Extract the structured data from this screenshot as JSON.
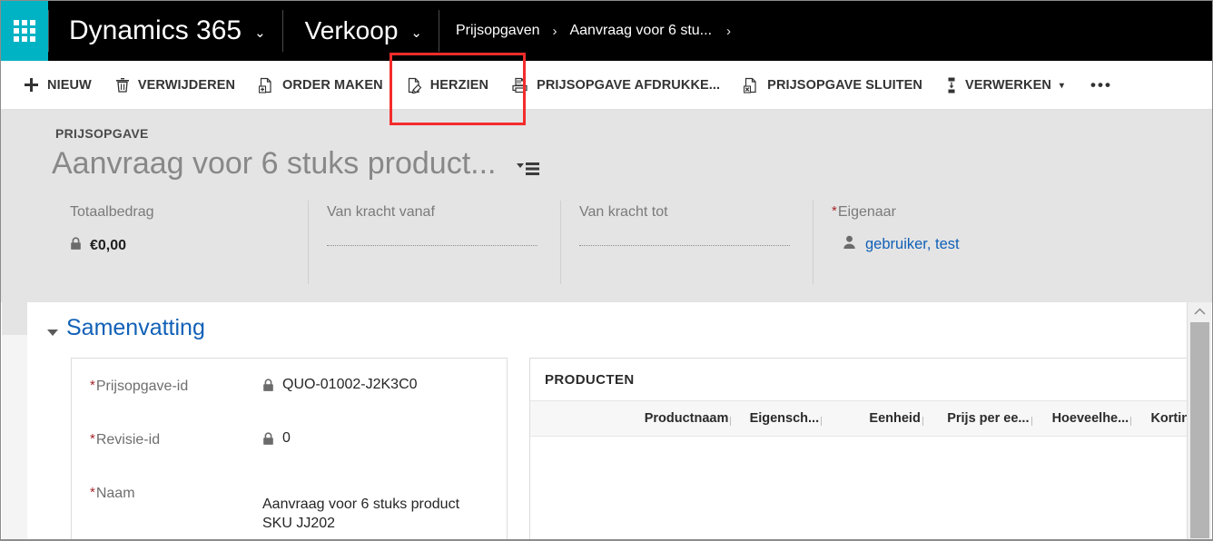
{
  "navbar": {
    "waffle_label": "app-launcher",
    "brand": "Dynamics 365",
    "brand_chevron": "⌄",
    "area": "Verkoop",
    "area_chevron": "⌄",
    "breadcrumbs": [
      {
        "label": "Prijsopgaven"
      },
      {
        "label": "Aanvraag voor 6 stu..."
      }
    ],
    "separator": "›"
  },
  "commandbar": {
    "items": [
      {
        "label": "NIEUW",
        "icon": "plus-icon",
        "has_caret": false
      },
      {
        "label": "VERWIJDEREN",
        "icon": "trash-icon",
        "has_caret": false
      },
      {
        "label": "ORDER MAKEN",
        "icon": "document-add-icon",
        "has_caret": false
      },
      {
        "label": "HERZIEN",
        "icon": "document-edit-icon",
        "has_caret": false
      },
      {
        "label": "PRIJSOPGAVE AFDRUKKE...",
        "icon": "printer-icon",
        "has_caret": false
      },
      {
        "label": "PRIJSOPGAVE SLUITEN",
        "icon": "document-close-icon",
        "has_caret": false
      },
      {
        "label": "VERWERKEN",
        "icon": "process-icon",
        "has_caret": true,
        "caret": "▾"
      }
    ],
    "overflow_label": "•••",
    "highlight": {
      "target": "HERZIEN",
      "color": "#f42c2c"
    }
  },
  "record_header": {
    "entity_label": "PRIJSOPGAVE",
    "title": "Aanvraag voor 6 stuks product...",
    "title_menu_icon": "record-set-menu-icon",
    "fields": [
      {
        "label": "Totaalbedrag",
        "required": false,
        "value": "€0,00",
        "locked": true,
        "type": "text"
      },
      {
        "label": "Van kracht vanaf",
        "required": false,
        "value": "",
        "locked": false,
        "type": "empty"
      },
      {
        "label": "Van kracht tot",
        "required": false,
        "value": "",
        "locked": false,
        "type": "empty"
      },
      {
        "label": "Eigenaar",
        "required": true,
        "value": "gebruiker, test",
        "locked": false,
        "type": "lookup"
      }
    ]
  },
  "form": {
    "section_title": "Samenvatting",
    "section_expanded": true,
    "fields": [
      {
        "label": "Prijsopgave-id",
        "required": true,
        "locked": true,
        "value": "QUO-01002-J2K3C0"
      },
      {
        "label": "Revisie-id",
        "required": true,
        "locked": true,
        "value": "0"
      },
      {
        "label": "Naam",
        "required": true,
        "locked": false,
        "value": "Aanvraag voor 6 stuks product SKU JJ202"
      }
    ]
  },
  "products_grid": {
    "title": "PRODUCTEN",
    "columns": [
      "Productnaam",
      "Eigensch...",
      "Eenheid",
      "Prijs per ee...",
      "Hoeveelhe...",
      "Korting"
    ],
    "rows": []
  },
  "scrollbar": {
    "up_arrow": "⌃",
    "orientation": "vertical"
  },
  "colors": {
    "navbar_bg": "#000000",
    "accent_teal": "#00b3c4",
    "link_blue": "#1160b7",
    "header_bg": "#e4e4e4",
    "required_red": "#a4262c",
    "highlight_red": "#f42c2c"
  }
}
